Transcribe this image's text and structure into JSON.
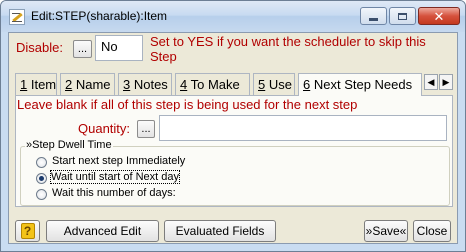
{
  "window": {
    "title": "Edit:STEP(sharable):Item"
  },
  "disable": {
    "label": "Disable:",
    "lookup_label": "...",
    "value": "No",
    "help_text_line1": "Set to YES if you want the scheduler to skip this",
    "help_text_line2": "Step"
  },
  "tabs": [
    {
      "num": "1",
      "label": " Item"
    },
    {
      "num": "2",
      "label": " Name"
    },
    {
      "num": "3",
      "label": " Notes"
    },
    {
      "num": "4",
      "label": " To Make"
    },
    {
      "num": "5",
      "label": " Use"
    },
    {
      "num": "6",
      "label": " Next Step Needs"
    }
  ],
  "tab_scroll": {
    "left": "◀",
    "right": "▶"
  },
  "panel": {
    "instruction": "Leave blank if all of this step is being used for the next step",
    "quantity_label": "Quantity:",
    "quantity_lookup_label": "...",
    "quantity_value": "",
    "dwell_group_title": "»Step Dwell Time",
    "options": [
      {
        "label": "Start next step Immediately",
        "checked": false
      },
      {
        "label": "Wait until start of Next day",
        "checked": true
      },
      {
        "label": "Wait this number of days:",
        "checked": false
      }
    ]
  },
  "footer": {
    "help_glyph": "?",
    "advanced_edit": "Advanced Edit",
    "evaluated_fields": "Evaluated Fields",
    "save": "»Save«",
    "close": "Close"
  }
}
